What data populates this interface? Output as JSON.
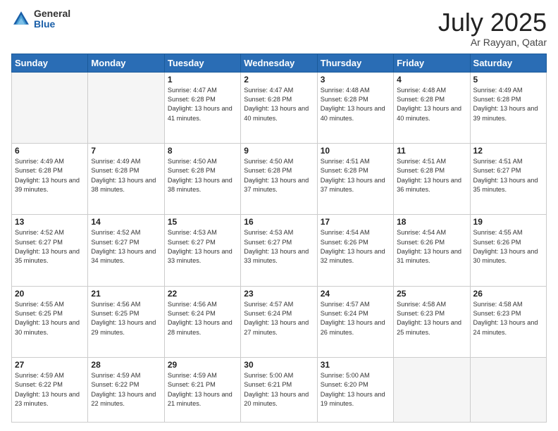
{
  "header": {
    "logo_general": "General",
    "logo_blue": "Blue",
    "month_title": "July 2025",
    "subtitle": "Ar Rayyan, Qatar"
  },
  "columns": [
    "Sunday",
    "Monday",
    "Tuesday",
    "Wednesday",
    "Thursday",
    "Friday",
    "Saturday"
  ],
  "weeks": [
    [
      {
        "day": "",
        "info": ""
      },
      {
        "day": "",
        "info": ""
      },
      {
        "day": "1",
        "info": "Sunrise: 4:47 AM\nSunset: 6:28 PM\nDaylight: 13 hours and 41 minutes."
      },
      {
        "day": "2",
        "info": "Sunrise: 4:47 AM\nSunset: 6:28 PM\nDaylight: 13 hours and 40 minutes."
      },
      {
        "day": "3",
        "info": "Sunrise: 4:48 AM\nSunset: 6:28 PM\nDaylight: 13 hours and 40 minutes."
      },
      {
        "day": "4",
        "info": "Sunrise: 4:48 AM\nSunset: 6:28 PM\nDaylight: 13 hours and 40 minutes."
      },
      {
        "day": "5",
        "info": "Sunrise: 4:49 AM\nSunset: 6:28 PM\nDaylight: 13 hours and 39 minutes."
      }
    ],
    [
      {
        "day": "6",
        "info": "Sunrise: 4:49 AM\nSunset: 6:28 PM\nDaylight: 13 hours and 39 minutes."
      },
      {
        "day": "7",
        "info": "Sunrise: 4:49 AM\nSunset: 6:28 PM\nDaylight: 13 hours and 38 minutes."
      },
      {
        "day": "8",
        "info": "Sunrise: 4:50 AM\nSunset: 6:28 PM\nDaylight: 13 hours and 38 minutes."
      },
      {
        "day": "9",
        "info": "Sunrise: 4:50 AM\nSunset: 6:28 PM\nDaylight: 13 hours and 37 minutes."
      },
      {
        "day": "10",
        "info": "Sunrise: 4:51 AM\nSunset: 6:28 PM\nDaylight: 13 hours and 37 minutes."
      },
      {
        "day": "11",
        "info": "Sunrise: 4:51 AM\nSunset: 6:28 PM\nDaylight: 13 hours and 36 minutes."
      },
      {
        "day": "12",
        "info": "Sunrise: 4:51 AM\nSunset: 6:27 PM\nDaylight: 13 hours and 35 minutes."
      }
    ],
    [
      {
        "day": "13",
        "info": "Sunrise: 4:52 AM\nSunset: 6:27 PM\nDaylight: 13 hours and 35 minutes."
      },
      {
        "day": "14",
        "info": "Sunrise: 4:52 AM\nSunset: 6:27 PM\nDaylight: 13 hours and 34 minutes."
      },
      {
        "day": "15",
        "info": "Sunrise: 4:53 AM\nSunset: 6:27 PM\nDaylight: 13 hours and 33 minutes."
      },
      {
        "day": "16",
        "info": "Sunrise: 4:53 AM\nSunset: 6:27 PM\nDaylight: 13 hours and 33 minutes."
      },
      {
        "day": "17",
        "info": "Sunrise: 4:54 AM\nSunset: 6:26 PM\nDaylight: 13 hours and 32 minutes."
      },
      {
        "day": "18",
        "info": "Sunrise: 4:54 AM\nSunset: 6:26 PM\nDaylight: 13 hours and 31 minutes."
      },
      {
        "day": "19",
        "info": "Sunrise: 4:55 AM\nSunset: 6:26 PM\nDaylight: 13 hours and 30 minutes."
      }
    ],
    [
      {
        "day": "20",
        "info": "Sunrise: 4:55 AM\nSunset: 6:25 PM\nDaylight: 13 hours and 30 minutes."
      },
      {
        "day": "21",
        "info": "Sunrise: 4:56 AM\nSunset: 6:25 PM\nDaylight: 13 hours and 29 minutes."
      },
      {
        "day": "22",
        "info": "Sunrise: 4:56 AM\nSunset: 6:24 PM\nDaylight: 13 hours and 28 minutes."
      },
      {
        "day": "23",
        "info": "Sunrise: 4:57 AM\nSunset: 6:24 PM\nDaylight: 13 hours and 27 minutes."
      },
      {
        "day": "24",
        "info": "Sunrise: 4:57 AM\nSunset: 6:24 PM\nDaylight: 13 hours and 26 minutes."
      },
      {
        "day": "25",
        "info": "Sunrise: 4:58 AM\nSunset: 6:23 PM\nDaylight: 13 hours and 25 minutes."
      },
      {
        "day": "26",
        "info": "Sunrise: 4:58 AM\nSunset: 6:23 PM\nDaylight: 13 hours and 24 minutes."
      }
    ],
    [
      {
        "day": "27",
        "info": "Sunrise: 4:59 AM\nSunset: 6:22 PM\nDaylight: 13 hours and 23 minutes."
      },
      {
        "day": "28",
        "info": "Sunrise: 4:59 AM\nSunset: 6:22 PM\nDaylight: 13 hours and 22 minutes."
      },
      {
        "day": "29",
        "info": "Sunrise: 4:59 AM\nSunset: 6:21 PM\nDaylight: 13 hours and 21 minutes."
      },
      {
        "day": "30",
        "info": "Sunrise: 5:00 AM\nSunset: 6:21 PM\nDaylight: 13 hours and 20 minutes."
      },
      {
        "day": "31",
        "info": "Sunrise: 5:00 AM\nSunset: 6:20 PM\nDaylight: 13 hours and 19 minutes."
      },
      {
        "day": "",
        "info": ""
      },
      {
        "day": "",
        "info": ""
      }
    ]
  ]
}
